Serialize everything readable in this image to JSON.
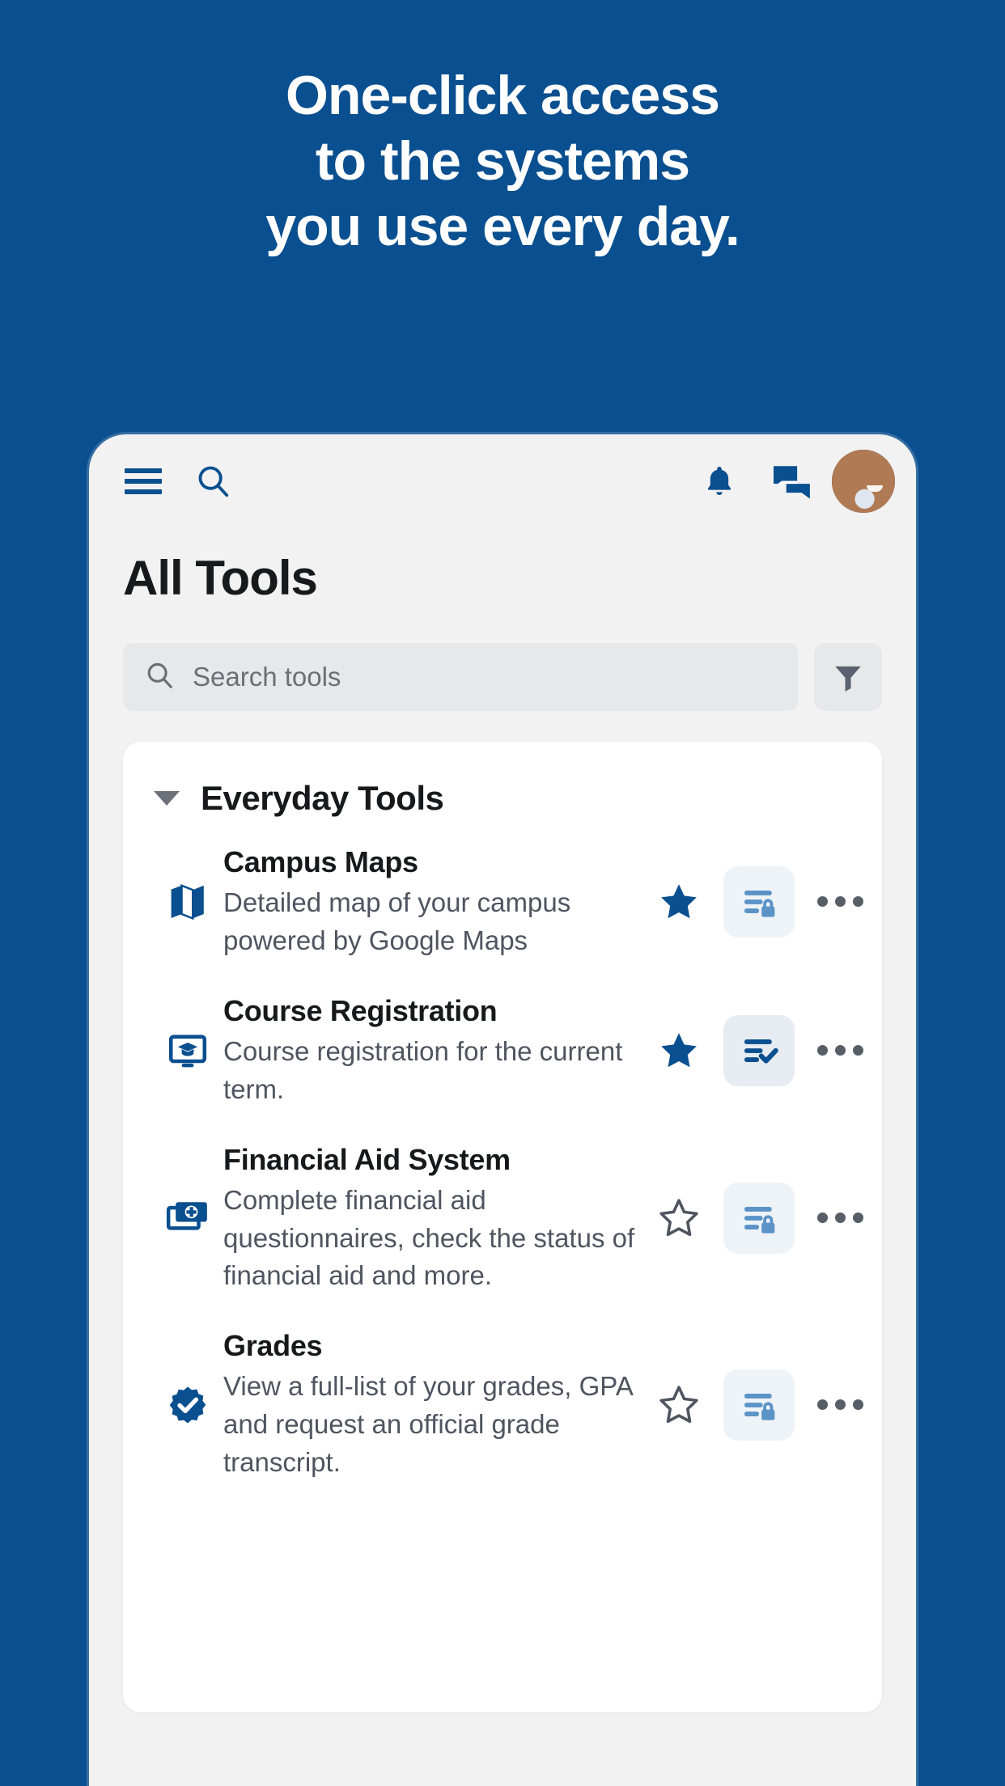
{
  "hero": {
    "lines": [
      "One-click access",
      "to the systems",
      "you use every day."
    ]
  },
  "colors": {
    "background_blue": "#0a4f8f",
    "brand_blue": "#0a4f8f",
    "app_background": "#f2f2f2",
    "card_white": "#ffffff",
    "search_field": "#e7e8ea",
    "text_dark": "#17191c",
    "text_muted": "#4e5560",
    "badge_locked_bg": "#eef3f8",
    "badge_locked_fg": "#5b93c7",
    "badge_checked_bg": "#e7ecf2",
    "badge_checked_fg": "#0a4f8f",
    "star_filled": "#0a4f8f",
    "star_empty": "#4e5560",
    "filter_icon": "#5b616e"
  },
  "appbar": {
    "menu_icon": "hamburger-menu-icon",
    "search_icon": "search-icon",
    "notifications_icon": "bell-icon",
    "messages_icon": "chat-bubbles-icon",
    "avatar": "user-avatar"
  },
  "page": {
    "title": "All Tools"
  },
  "search": {
    "placeholder": "Search tools",
    "value": "",
    "icon": "search-icon",
    "filter_icon": "filter-funnel-icon"
  },
  "group": {
    "label": "Everyday Tools",
    "expanded": true,
    "caret_icon": "chevron-down-icon"
  },
  "tools": [
    {
      "name": "Campus Maps",
      "description": "Detailed map of your campus powered by Google Maps",
      "icon": "map-icon",
      "favorite": true,
      "star_icon": "star-filled-icon",
      "badge": "locked",
      "badge_icon": "list-lock-icon",
      "menu_icon": "more-options-icon"
    },
    {
      "name": "Course Registration",
      "description": "Course registration for the current term.",
      "icon": "monitor-graduation-cap-icon",
      "favorite": true,
      "star_icon": "star-filled-icon",
      "badge": "checked",
      "badge_icon": "list-check-icon",
      "menu_icon": "more-options-icon"
    },
    {
      "name": "Financial Aid System",
      "description": "Complete financial aid questionnaires, check the status of financial aid and more.",
      "icon": "money-plus-icon",
      "favorite": false,
      "star_icon": "star-outline-icon",
      "badge": "locked",
      "badge_icon": "list-lock-icon",
      "menu_icon": "more-options-icon"
    },
    {
      "name": "Grades",
      "description": "View a full-list of your grades, GPA and request an official grade transcript.",
      "icon": "verified-badge-icon",
      "favorite": false,
      "star_icon": "star-outline-icon",
      "badge": "locked",
      "badge_icon": "list-lock-icon",
      "menu_icon": "more-options-icon"
    }
  ]
}
